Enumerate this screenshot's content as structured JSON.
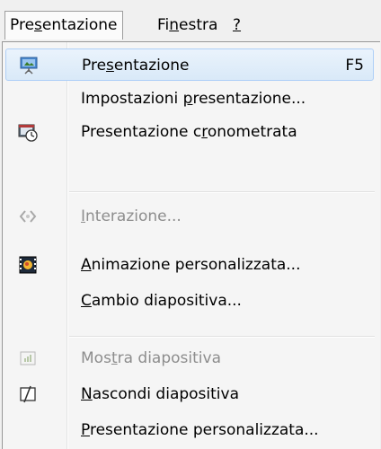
{
  "menubar": {
    "items": [
      {
        "pre": "Pre",
        "ul": "s",
        "post": "entazione"
      },
      {
        "pre": "Fi",
        "ul": "n",
        "post": "estra"
      },
      {
        "pre": "",
        "ul": "?",
        "post": ""
      }
    ]
  },
  "menu": {
    "items": [
      {
        "pre": "Pre",
        "ul": "s",
        "post": "entazione",
        "shortcut": "F5",
        "icon": "presentation-screen-icon"
      },
      {
        "pre": "Impostazioni ",
        "ul": "p",
        "post": "resentazione...",
        "shortcut": "",
        "icon": ""
      },
      {
        "pre": "Presentazione c",
        "ul": "r",
        "post": "onometrata",
        "shortcut": "",
        "icon": "timer-presentation-icon"
      },
      {
        "pre": "",
        "ul": "I",
        "post": "nterazione...",
        "shortcut": "",
        "icon": "interaction-icon"
      },
      {
        "pre": "",
        "ul": "A",
        "post": "nimazione personalizzata...",
        "shortcut": "",
        "icon": "custom-animation-icon"
      },
      {
        "pre": "",
        "ul": "C",
        "post": "ambio diapositiva...",
        "shortcut": "",
        "icon": ""
      },
      {
        "pre": "Mos",
        "ul": "t",
        "post": "ra diapositiva",
        "shortcut": "",
        "icon": "show-slide-icon"
      },
      {
        "pre": "",
        "ul": "N",
        "post": "ascondi diapositiva",
        "shortcut": "",
        "icon": "hide-slide-icon"
      },
      {
        "pre": "",
        "ul": "P",
        "post": "resentazione personalizzata...",
        "shortcut": "",
        "icon": ""
      }
    ]
  }
}
